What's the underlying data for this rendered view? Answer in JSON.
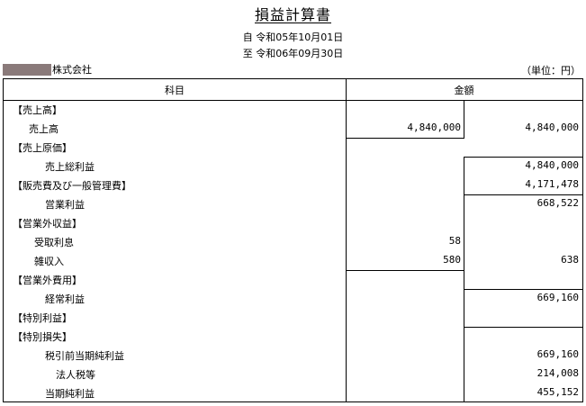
{
  "title": "損益計算書",
  "period_from": "自 令和05年10月01日",
  "period_to": "至 令和06年09月30日",
  "company_suffix": "株式会社",
  "unit": "（単位：円）",
  "headers": {
    "kamoku": "科目",
    "kingaku": "金額"
  },
  "rows": [
    {
      "label": "【売上高】",
      "a1": "",
      "a2": ""
    },
    {
      "label": "売上高",
      "a1": "4,840,000",
      "a2": "4,840,000"
    },
    {
      "label": "【売上原価】",
      "a1": "",
      "a2": ""
    },
    {
      "label": "売上総利益",
      "a1": "",
      "a2": "4,840,000"
    },
    {
      "label": "【販売費及び一般管理費】",
      "a1": "",
      "a2": "4,171,478"
    },
    {
      "label": "営業利益",
      "a1": "",
      "a2": "668,522"
    },
    {
      "label": "【営業外収益】",
      "a1": "",
      "a2": ""
    },
    {
      "label": "受取利息",
      "a1": "58",
      "a2": ""
    },
    {
      "label": "雑収入",
      "a1": "580",
      "a2": "638"
    },
    {
      "label": "【営業外費用】",
      "a1": "",
      "a2": ""
    },
    {
      "label": "経常利益",
      "a1": "",
      "a2": "669,160"
    },
    {
      "label": "【特別利益】",
      "a1": "",
      "a2": ""
    },
    {
      "label": "【特別損失】",
      "a1": "",
      "a2": ""
    },
    {
      "label": "税引前当期純利益",
      "a1": "",
      "a2": "669,160"
    },
    {
      "label": "法人税等",
      "a1": "",
      "a2": "214,008"
    },
    {
      "label": "当期純利益",
      "a1": "",
      "a2": "455,152"
    }
  ]
}
